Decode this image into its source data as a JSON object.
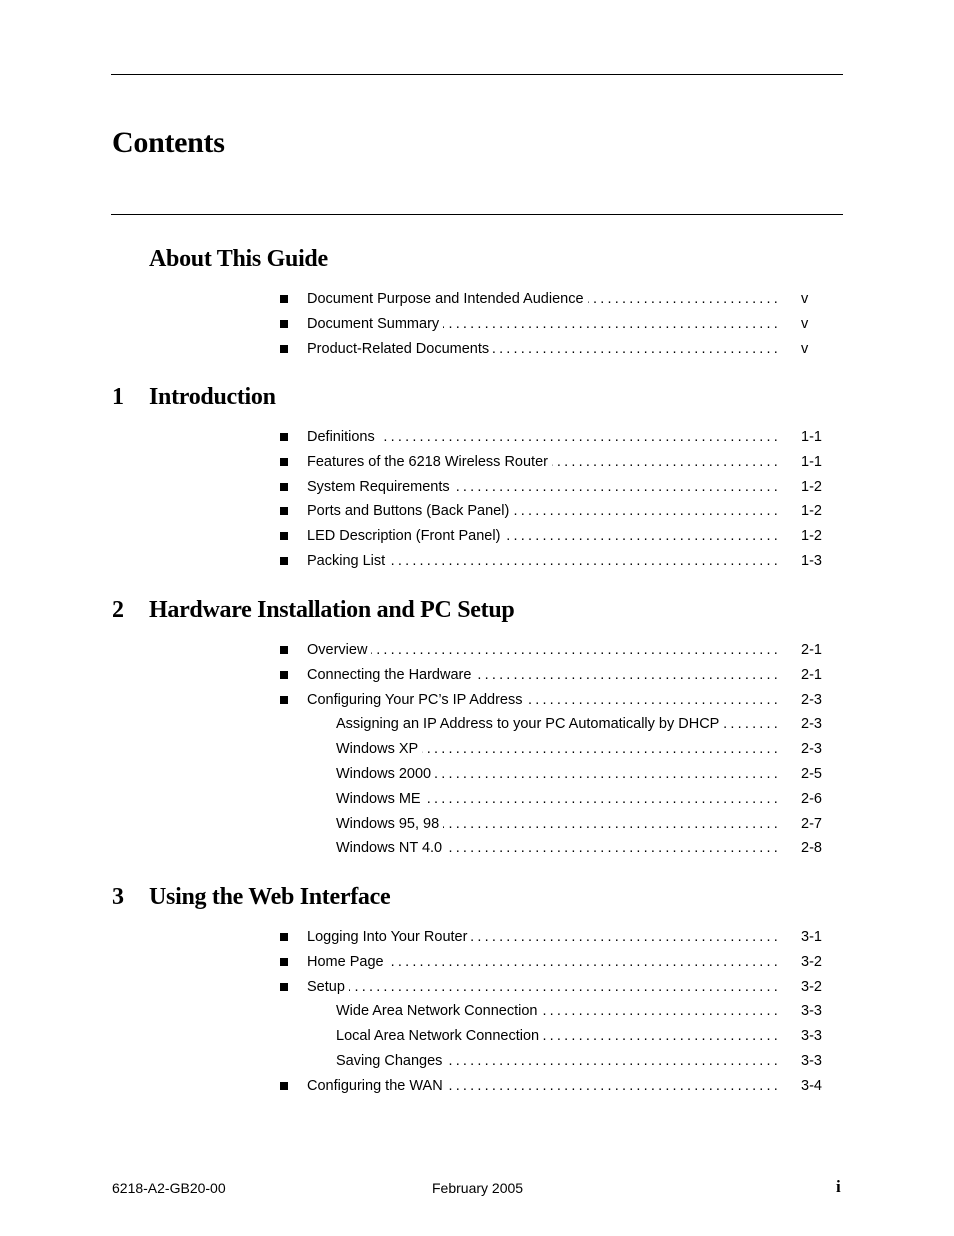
{
  "document": {
    "title": "Contents"
  },
  "sections": [
    {
      "number": "",
      "title": "About This Guide",
      "entries": [
        {
          "label": "Document Purpose and Intended Audience",
          "page": "v",
          "level": 1
        },
        {
          "label": "Document Summary",
          "page": "v",
          "level": 1
        },
        {
          "label": "Product-Related Documents",
          "page": "v",
          "level": 1
        }
      ]
    },
    {
      "number": "1",
      "title": "Introduction",
      "entries": [
        {
          "label": "Definitions",
          "page": "1-1",
          "level": 1
        },
        {
          "label": "Features of the 6218 Wireless Router",
          "page": "1-1",
          "level": 1
        },
        {
          "label": "System Requirements",
          "page": "1-2",
          "level": 1
        },
        {
          "label": "Ports and Buttons (Back Panel)",
          "page": "1-2",
          "level": 1
        },
        {
          "label": "LED Description (Front Panel)",
          "page": "1-2",
          "level": 1
        },
        {
          "label": "Packing List",
          "page": "1-3",
          "level": 1
        }
      ]
    },
    {
      "number": "2",
      "title": "Hardware Installation and PC Setup",
      "entries": [
        {
          "label": "Overview",
          "page": "2-1",
          "level": 1
        },
        {
          "label": "Connecting the Hardware",
          "page": "2-1",
          "level": 1
        },
        {
          "label": "Configuring Your PC’s IP Address",
          "page": "2-3",
          "level": 1
        },
        {
          "label": "Assigning an IP Address to your PC Automatically by DHCP",
          "page": "2-3",
          "level": 2
        },
        {
          "label": "Windows XP",
          "page": "2-3",
          "level": 2
        },
        {
          "label": "Windows 2000",
          "page": "2-5",
          "level": 2
        },
        {
          "label": "Windows ME",
          "page": "2-6",
          "level": 2
        },
        {
          "label": "Windows 95, 98",
          "page": "2-7",
          "level": 2
        },
        {
          "label": "Windows NT 4.0",
          "page": "2-8",
          "level": 2
        }
      ]
    },
    {
      "number": "3",
      "title": "Using the Web Interface",
      "entries": [
        {
          "label": "Logging Into Your Router",
          "page": "3-1",
          "level": 1
        },
        {
          "label": "Home Page",
          "page": "3-2",
          "level": 1
        },
        {
          "label": "Setup",
          "page": "3-2",
          "level": 1
        },
        {
          "label": "Wide Area Network Connection",
          "page": "3-3",
          "level": 2
        },
        {
          "label": "Local Area Network Connection",
          "page": "3-3",
          "level": 2
        },
        {
          "label": "Saving Changes",
          "page": "3-3",
          "level": 2
        },
        {
          "label": "Configuring the WAN",
          "page": "3-4",
          "level": 1
        }
      ]
    }
  ],
  "icons": {
    "bullet": "square-bullet-icon"
  },
  "footer": {
    "doc_number": "6218-A2-GB20-00",
    "date": "February 2005",
    "page": "i"
  }
}
